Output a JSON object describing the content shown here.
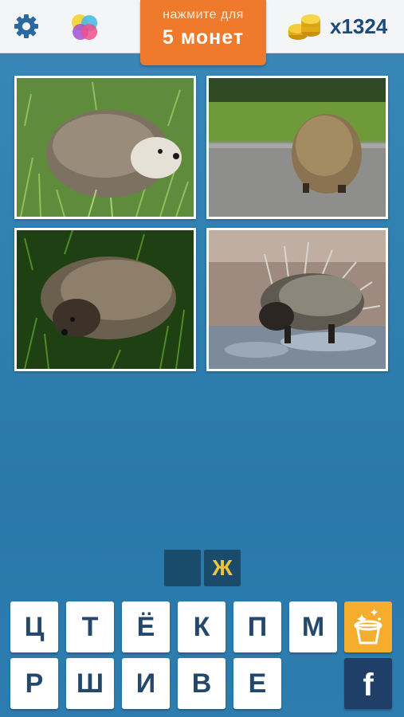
{
  "header": {
    "promo_line1": "нажмите для",
    "promo_line2": "5 монет",
    "coin_count": "x1324"
  },
  "photos": [
    {
      "subject": "hedgehog-in-grass"
    },
    {
      "subject": "hedgehog-on-road"
    },
    {
      "subject": "hedgehog-in-dark-grass"
    },
    {
      "subject": "porcupine-in-puddle"
    }
  ],
  "answer_slots": [
    "",
    "Ж"
  ],
  "letters_row1": [
    "Ц",
    "Т",
    "Ё",
    "К",
    "П",
    "М"
  ],
  "letters_row2": [
    "Р",
    "Ш",
    "И",
    "В",
    "Е"
  ],
  "helpers": {
    "hint_icon": "magic-hat-icon",
    "share_label": "f"
  },
  "colors": {
    "background": "#2f7fb1",
    "promo": "#f07a2c",
    "coin_text": "#1d4a78",
    "slot": "#1b4b6b",
    "slot_letter": "#f0c43a",
    "tile_text": "#23486b",
    "hint": "#f4ad2c",
    "facebook": "#1f3f68"
  }
}
